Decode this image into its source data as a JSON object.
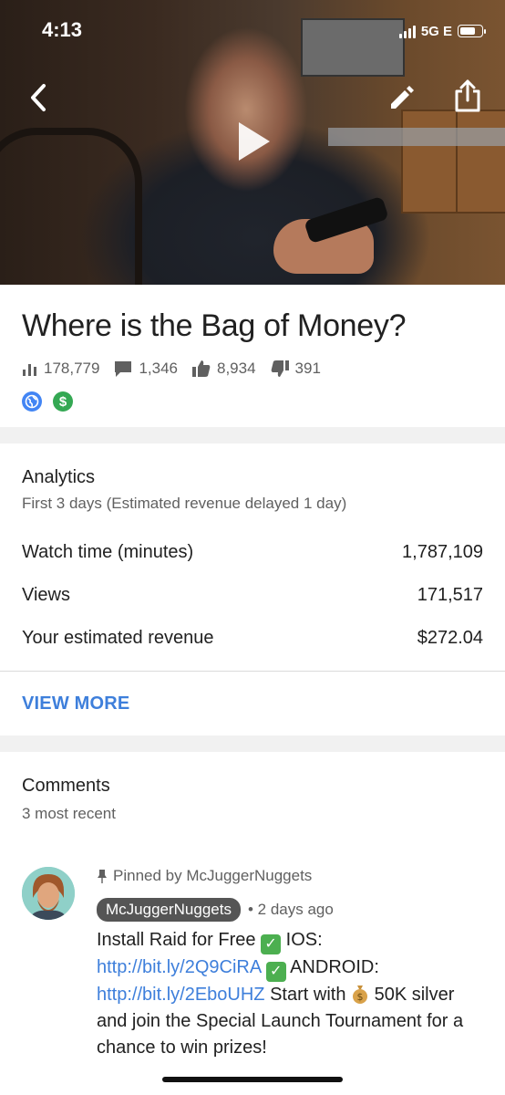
{
  "status_bar": {
    "time": "4:13",
    "network": "5G E"
  },
  "video": {
    "icons": {
      "back": "back-arrow-icon",
      "edit": "pencil-icon",
      "share": "share-icon",
      "play": "play-icon"
    }
  },
  "video_info": {
    "title": "Where is the Bag of Money?",
    "stats": {
      "views": "178,779",
      "comments": "1,346",
      "likes": "8,934",
      "dislikes": "391"
    },
    "badges": [
      "globe-icon",
      "monetization-icon"
    ],
    "badge_colors": {
      "globe": "#4285f4",
      "money": "#34a853"
    }
  },
  "analytics": {
    "title": "Analytics",
    "subtitle": "First 3 days (Estimated revenue delayed 1 day)",
    "rows": [
      {
        "label": "Watch time (minutes)",
        "value": "1,787,109"
      },
      {
        "label": "Views",
        "value": "171,517"
      },
      {
        "label": "Your estimated revenue",
        "value": "$272.04"
      }
    ],
    "view_more": "VIEW MORE",
    "accent": "#3e7fdb"
  },
  "comments": {
    "title": "Comments",
    "subtitle": "3 most recent",
    "items": [
      {
        "pinned": "Pinned by McJuggerNuggets",
        "author": "McJuggerNuggets",
        "time": "• 2 days ago",
        "text": {
          "p1": "Install Raid for Free ",
          "p2": " IOS: ",
          "link1": "http://bit.ly/2Q9CiRA",
          "p3": " ANDROID: ",
          "link2": "http://bit.ly/2EboUHZ",
          "p4": " Start with ",
          "p5": " 50K silver and join the Special Launch Tournament for a chance to win prizes!"
        }
      }
    ]
  }
}
